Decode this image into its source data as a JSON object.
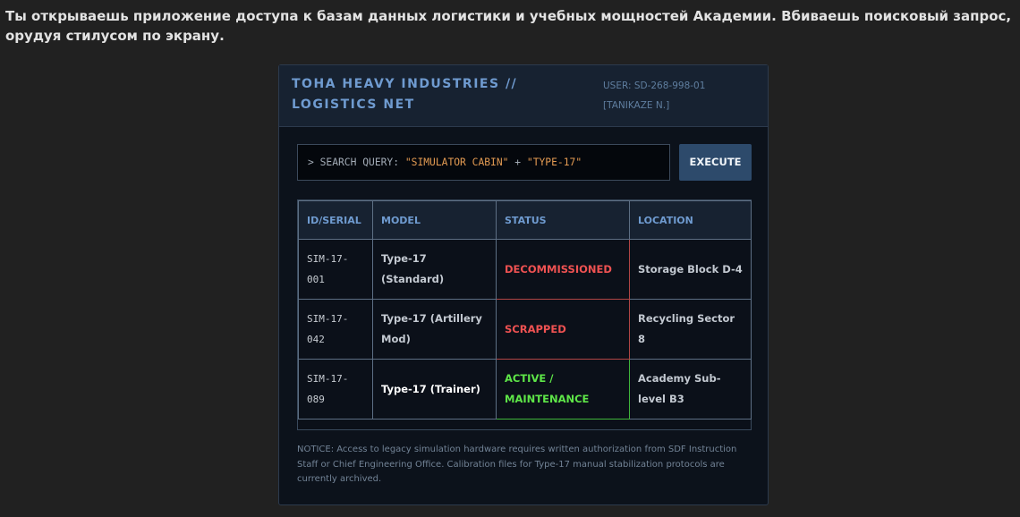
{
  "narration": "Ты открываешь приложение доступа к базам данных логистики и учебных мощностей Академии. Вбиваешь поисковый запрос, орудуя стилусом по экрану.",
  "header": {
    "title": "TOHA HEAVY INDUSTRIES // LOGISTICS NET",
    "user": "USER: SD-268-998-01 [TANIKAZE N.]"
  },
  "search": {
    "prefix": "> SEARCH QUERY:",
    "term1": "\"SIMULATOR CABIN\"",
    "operator": "+",
    "term2": "\"TYPE-17\"",
    "execute_label": "EXECUTE"
  },
  "table": {
    "columns": [
      "ID/SERIAL",
      "MODEL",
      "STATUS",
      "LOCATION"
    ],
    "rows": [
      {
        "id": "SIM-17-001",
        "model": "Type-17 (Standard)",
        "status": "DECOMMISSIONED",
        "location": "Storage Block D-4"
      },
      {
        "id": "SIM-17-042",
        "model": "Type-17 (Artillery Mod)",
        "status": "SCRAPPED",
        "location": "Recycling Sector 8"
      },
      {
        "id": "SIM-17-089",
        "model": "Type-17 (Trainer)",
        "status": "ACTIVE / MAINTENANCE",
        "location": "Academy Sub-level B3"
      }
    ]
  },
  "notice": "NOTICE: Access to legacy simulation hardware requires written authorization from SDF Instruction Staff or Chief Engineering Office. Calibration files for Type-17 manual stabilization protocols are currently archived.",
  "colors": {
    "accent": "#6f9bd0",
    "status_inactive": "#ef5252",
    "status_active": "#5ee648",
    "query_term": "#e29a52"
  }
}
